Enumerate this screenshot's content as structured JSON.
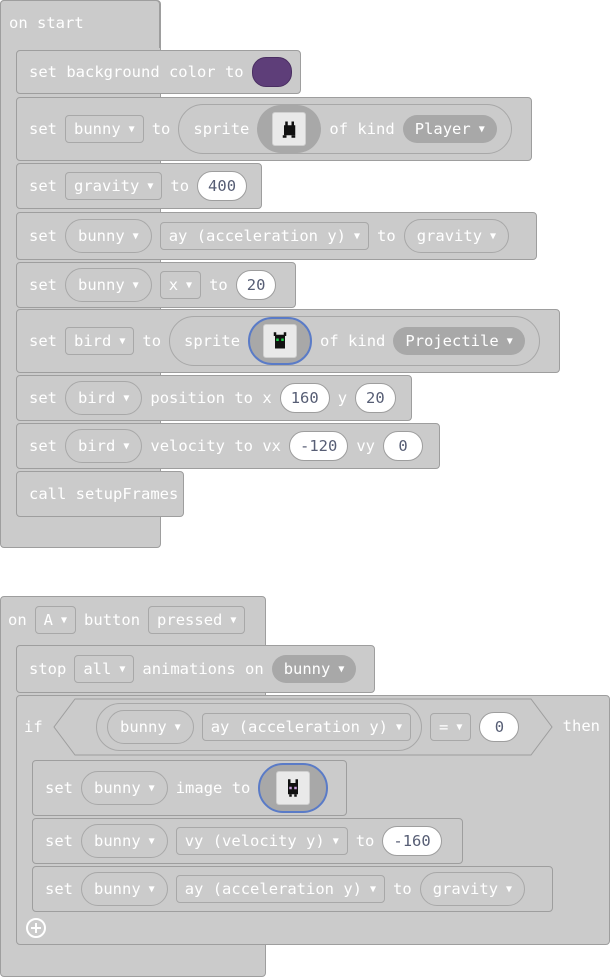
{
  "on_start": {
    "hat_label": "on start",
    "stmt1": {
      "set": "set background color to",
      "color": "#5e3e79",
      "color_name": "background color swatch"
    },
    "stmt2": {
      "set": "set",
      "var": "bunny",
      "to": "to",
      "sprite": "sprite",
      "of_kind": "of kind",
      "kind": "Player"
    },
    "stmt3": {
      "set": "set",
      "var": "gravity",
      "to": "to",
      "value": "400"
    },
    "stmt4": {
      "set": "set",
      "var": "bunny",
      "prop": "ay (acceleration y)",
      "to": "to",
      "value_var": "gravity"
    },
    "stmt5": {
      "set": "set",
      "var": "bunny",
      "prop": "x",
      "to": "to",
      "value": "20"
    },
    "stmt6": {
      "set": "set",
      "var": "bird",
      "to": "to",
      "sprite": "sprite",
      "of_kind": "of kind",
      "kind": "Projectile"
    },
    "stmt7": {
      "set": "set",
      "var": "bird",
      "position_to_x": "position to x",
      "x": "160",
      "y_label": "y",
      "y": "20"
    },
    "stmt8": {
      "set": "set",
      "var": "bird",
      "velocity_to_vx": "velocity to vx",
      "vx": "-120",
      "vy_label": "vy",
      "vy": "0"
    },
    "stmt9": {
      "call": "call setupFrames"
    }
  },
  "on_button": {
    "on": "on",
    "button": "A",
    "button_label": "button",
    "event": "pressed",
    "stop": {
      "stop": "stop",
      "which": "all",
      "animations_on": "animations on",
      "var": "bunny"
    },
    "if_block": {
      "if": "if",
      "var": "bunny",
      "prop": "ay (acceleration y)",
      "op": "=",
      "value": "0",
      "then": "then"
    },
    "inner1": {
      "set": "set",
      "var": "bunny",
      "image_to": "image to"
    },
    "inner2": {
      "set": "set",
      "var": "bunny",
      "prop": "vy (velocity y)",
      "to": "to",
      "value": "-160"
    },
    "inner3": {
      "set": "set",
      "var": "bunny",
      "prop": "ay (acceleration y)",
      "to": "to",
      "value_var": "gravity"
    },
    "add_icon": "plus-circle-icon"
  }
}
